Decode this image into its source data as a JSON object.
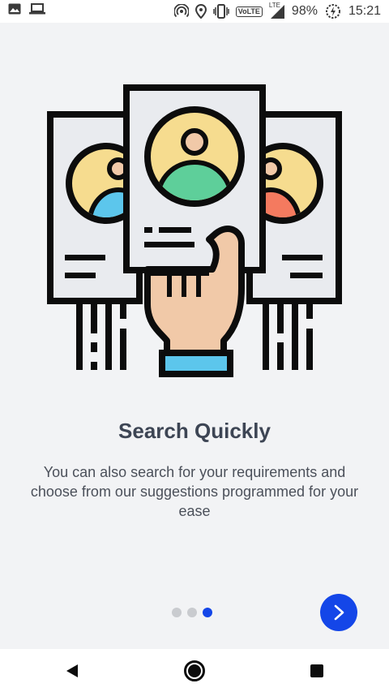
{
  "status_bar": {
    "battery": "98%",
    "time": "15:21",
    "volte": "VoLTE",
    "network_label": "LTE",
    "icons": [
      "image-icon",
      "laptop-icon",
      "hotspot-icon",
      "location-icon",
      "vibrate-icon",
      "signal-icon",
      "battery-saver-icon"
    ]
  },
  "onboarding": {
    "title": "Search Quickly",
    "description": "You can also search for your requirements and choose from our suggestions programmed for your ease",
    "illustration": "profile-search-illustration",
    "page_count": 3,
    "active_page": 3
  },
  "nav": {
    "next_icon": "chevron-right-icon",
    "back_icon": "back-triangle-icon",
    "home_icon": "home-circle-icon",
    "recents_icon": "recents-square-icon"
  },
  "colors": {
    "background": "#f2f3f5",
    "accent": "#1446e8",
    "dot_inactive": "#c9cbcf",
    "title": "#3d4554",
    "text": "#4b505a"
  }
}
